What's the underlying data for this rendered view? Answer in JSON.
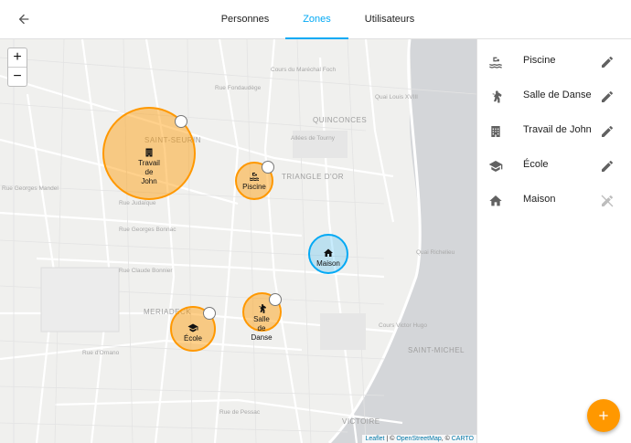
{
  "header": {
    "tabs": [
      {
        "label": "Personnes",
        "active": false
      },
      {
        "label": "Zones",
        "active": true
      },
      {
        "label": "Utilisateurs",
        "active": false
      }
    ]
  },
  "map": {
    "zoom_in": "+",
    "zoom_out": "−",
    "area_labels": [
      "SAINT-SEURIN",
      "QUINCONCES",
      "TRIANGLE D'OR",
      "MERIADECK",
      "SAINT-MICHEL",
      "VICTOIRE"
    ],
    "street_labels": [
      "Rue Judaïque",
      "Rue Georges Bonnac",
      "Rue Claude Bonnier",
      "Rue Georges Mandel",
      "Rue d'Ornano",
      "Cours Victor Hugo",
      "Quai Richelieu",
      "Quai Louis XVIII",
      "Cours du Maréchal Foch",
      "Allées de Tourny",
      "Rue de Pessac",
      "Rue Fondaudège"
    ],
    "zones": [
      {
        "name": "Travail de John",
        "lines": [
          "Travail",
          "de",
          "John"
        ],
        "icon": "office-building-icon",
        "color": "#ff9800"
      },
      {
        "name": "Piscine",
        "lines": [
          "Piscine"
        ],
        "icon": "pool-icon",
        "color": "#ff9800"
      },
      {
        "name": "Maison",
        "lines": [
          "Maison"
        ],
        "icon": "home-icon",
        "color": "#03a9f4"
      },
      {
        "name": "École",
        "lines": [
          "École"
        ],
        "icon": "school-icon",
        "color": "#ff9800"
      },
      {
        "name": "Salle de Danse",
        "lines": [
          "Salle",
          "de",
          "Danse"
        ],
        "icon": "dance-icon",
        "color": "#ff9800"
      }
    ],
    "attribution": {
      "leaflet": "Leaflet",
      "sep1": " | © ",
      "osm": "OpenStreetMap",
      "sep2": ", © ",
      "carto": "CARTO"
    }
  },
  "sidebar": {
    "items": [
      {
        "label": "Piscine",
        "icon": "pool-icon",
        "action": "pencil-icon",
        "editable": true
      },
      {
        "label": "Salle de Danse",
        "icon": "dance-icon",
        "action": "pencil-icon",
        "editable": true
      },
      {
        "label": "Travail de John",
        "icon": "office-building-icon",
        "action": "pencil-icon",
        "editable": true
      },
      {
        "label": "École",
        "icon": "school-icon",
        "action": "pencil-icon",
        "editable": true
      },
      {
        "label": "Maison",
        "icon": "home-icon",
        "action": "pencil-off-icon",
        "editable": false
      }
    ]
  },
  "fab": {
    "label": "+",
    "icon": "plus-icon"
  },
  "colors": {
    "accent": "#03a9f4",
    "zone": "#ff9800",
    "home_zone": "#03a9f4"
  }
}
